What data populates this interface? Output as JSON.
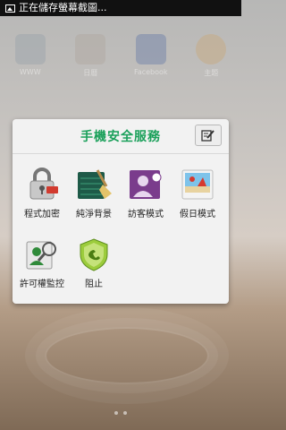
{
  "status_bar": {
    "notification_text": "正在儲存螢幕截圖..."
  },
  "dialog": {
    "title": "手機安全服務",
    "accent_color": "#1aa05a",
    "apps": [
      {
        "label": "程式加密",
        "icon": "padlock-app-icon"
      },
      {
        "label": "純淨背景",
        "icon": "clean-background-icon"
      },
      {
        "label": "訪客模式",
        "icon": "guest-mode-icon"
      },
      {
        "label": "假日模式",
        "icon": "holiday-mode-icon"
      },
      {
        "label": "許可權監控",
        "icon": "permission-monitor-icon"
      },
      {
        "label": "阻止",
        "icon": "block-shield-icon"
      }
    ]
  },
  "background_labels": [
    "WWW",
    "日曆",
    "Facebook",
    "主題"
  ]
}
